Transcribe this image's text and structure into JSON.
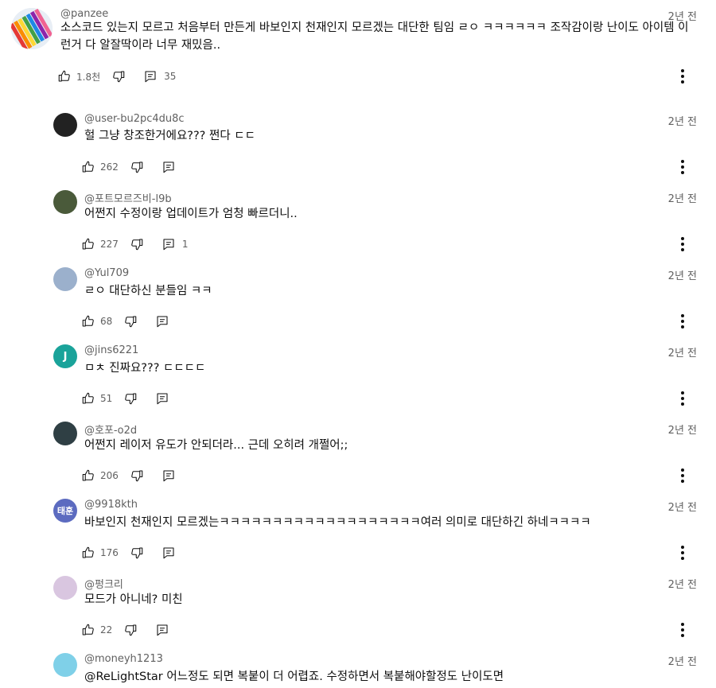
{
  "icons": {
    "like": "thumb-up-icon",
    "dislike": "thumb-down-icon",
    "reply": "reply-icon",
    "more": "more-vertical-icon"
  },
  "comments": [
    {
      "author": "@panzee",
      "time": "2년 전",
      "text": "소스코드 있는지 모르고 처음부터 만든게 바보인지 천재인지 모르겠는 대단한 팀임 ㄹㅇ ㅋㅋㅋㅋㅋㅋ 조작감이랑 난이도 아이템 이런거 다 알잘딱이라 너무 재밌음..",
      "likes": "1.8천",
      "replies": "35",
      "avatar_color": "#e8eef5",
      "avatar_letter": ""
    },
    {
      "author": "@user-bu2pc4du8c",
      "time": "2년 전",
      "text": "헐 그냥 창조한거에요??? 쩐다 ㄷㄷ",
      "likes": "262",
      "replies": "",
      "avatar_color": "#222222",
      "avatar_letter": ""
    },
    {
      "author": "@포트모르즈비-l9b",
      "time": "2년 전",
      "text": "어쩐지 수정이랑 업데이트가 엄청 빠르더니..",
      "likes": "227",
      "replies": "1",
      "avatar_color": "#4a5a3a",
      "avatar_letter": ""
    },
    {
      "author": "@Yul709",
      "time": "2년 전",
      "text": "ㄹㅇ 대단하신 분들임 ㅋㅋ",
      "likes": "68",
      "replies": "",
      "avatar_color": "#9bb0cc",
      "avatar_letter": ""
    },
    {
      "author": "@jins6221",
      "time": "2년 전",
      "text": "ㅁㅊ 진짜요??? ㄷㄷㄷㄷ",
      "likes": "51",
      "replies": "",
      "avatar_color": "#1aa39a",
      "avatar_letter": "J"
    },
    {
      "author": "@호포-o2d",
      "time": "2년 전",
      "text": "어쩐지 레이저 유도가 안되더라... 근데 오히려 개쩔어;;",
      "likes": "206",
      "replies": "",
      "avatar_color": "#2f3f44",
      "avatar_letter": ""
    },
    {
      "author": "@9918kth",
      "time": "2년 전",
      "text": "바보인지 천재인지 모르겠는ㅋㅋㅋㅋㅋㅋㅋㅋㅋㅋㅋㅋㅋㅋㅋㅋㅋㅋㅋ여러 의미로 대단하긴 하네ㅋㅋㅋㅋ",
      "likes": "176",
      "replies": "",
      "avatar_color": "#5c6bc0",
      "avatar_letter": "태훈"
    },
    {
      "author": "@펑크리",
      "time": "2년 전",
      "text": "모드가 아니네? 미친",
      "likes": "22",
      "replies": "",
      "avatar_color": "#d9c6e0",
      "avatar_letter": ""
    },
    {
      "author": "@moneyh1213",
      "time": "2년 전",
      "text": "@ReLightStar 어느정도 되면 복붙이 더 어렵죠. 수정하면서 복붙해야할정도 난이도면",
      "likes": "",
      "replies": "",
      "avatar_color": "#7fd0e8",
      "avatar_letter": ""
    }
  ]
}
